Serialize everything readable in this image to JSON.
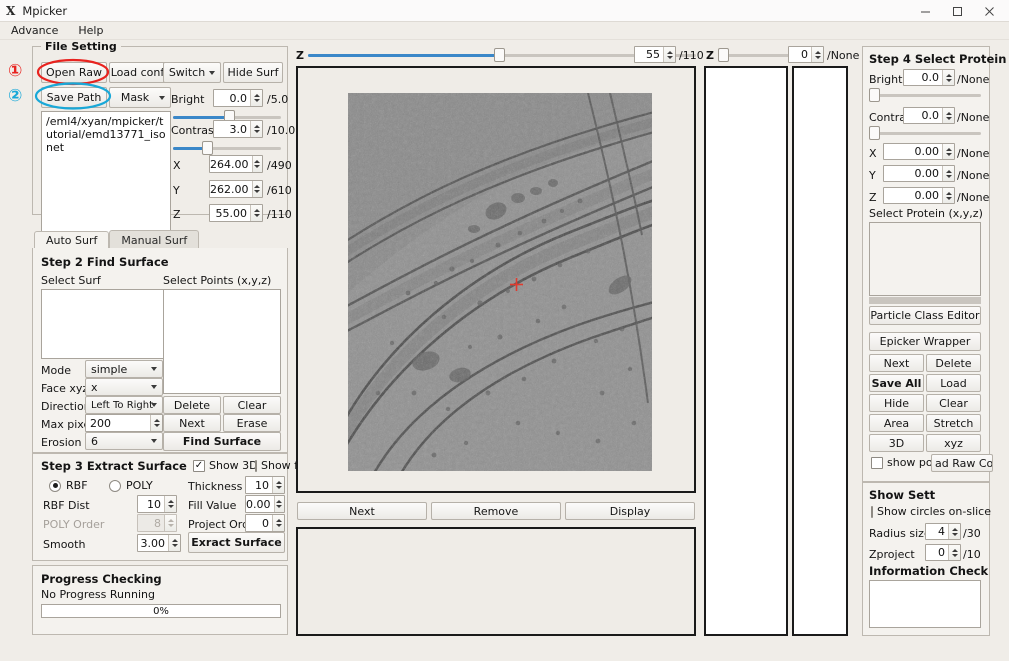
{
  "window": {
    "app_logo": "X",
    "title": "Mpicker",
    "minimize_icon": "minimize-icon",
    "maximize_icon": "maximize-icon",
    "close_icon": "close-icon"
  },
  "menubar": {
    "items": [
      "Advance",
      "Help"
    ]
  },
  "annotations": [
    {
      "number": "①",
      "target": "Open Raw",
      "color": "#e8231f"
    },
    {
      "number": "②",
      "target": "Save Path",
      "color": "#19a8d8"
    }
  ],
  "file_setting": {
    "title": "File Setting",
    "open_raw": "Open Raw",
    "load_config": "Load config",
    "switch": "Switch",
    "hide_surf": "Hide Surf",
    "save_path": "Save Path",
    "mask": "Mask",
    "path_value": "/eml4/xyan/mpicker/tutorial/emd13771_isonet",
    "bright_label": "Bright",
    "bright_value": "0.0",
    "bright_max": "/5.0",
    "bright_slider_pct": 50,
    "contrast_label": "Contrast",
    "contrast_value": "3.0",
    "contrast_max": "/10.0",
    "contrast_slider_pct": 30,
    "x_label": "X",
    "x_value": "264.00",
    "x_max": "/490",
    "y_label": "Y",
    "y_value": "262.00",
    "y_max": "/610",
    "z_label": "Z",
    "z_value": "55.00",
    "z_max": "/110"
  },
  "tabs": {
    "auto_surf": "Auto Surf",
    "manual_surf": "Manual Surf",
    "selected": "Auto Surf"
  },
  "step2": {
    "title": "Step 2 Find Surface",
    "select_surf_label": "Select Surf",
    "select_points_label": "Select Points (x,y,z)",
    "select_surf_items": [],
    "select_points_items": [],
    "mode_label": "Mode",
    "mode_value": "simple",
    "face_label": "Face xyz",
    "face_value": "x",
    "direction_label": "Direction",
    "direction_value": "Left To Right",
    "maxpixel_label": "Max pixel",
    "maxpixel_value": "200",
    "erosion_label": "Erosion",
    "erosion_value": "6",
    "delete": "Delete",
    "clear": "Clear",
    "next": "Next",
    "erase": "Erase",
    "find_surface": "Find Surface"
  },
  "step3": {
    "title": "Step 3 Extract Surface",
    "show3d_label": "Show 3D",
    "show3d_checked": true,
    "showfit_label": "Show fittin",
    "showfit_checked": false,
    "rbf_label": "RBF",
    "rbf_selected": true,
    "poly_label": "POLY",
    "poly_selected": false,
    "thickness_label": "Thickness",
    "thickness_value": "10",
    "rbfdist_label": "RBF Dist",
    "rbfdist_value": "10",
    "fillvalue_label": "Fill Value",
    "fillvalue_value": "0.00",
    "polyorder_label": "POLY Order",
    "polyorder_value": "8",
    "polyorder_disabled": true,
    "projectorder_label": "Project Order",
    "projectorder_value": "0",
    "smooth_label": "Smooth",
    "smooth_value": "3.00",
    "extract_surface": "Exract Surface"
  },
  "progress": {
    "title": "Progress Checking",
    "status": "No Progress Running",
    "percent_label": "0%",
    "percent": 0
  },
  "viewer": {
    "z_label": "Z",
    "z_value": "55",
    "z_max": "/110",
    "z_slider_pct": 50,
    "z2_label": "Z",
    "z2_value": "0",
    "z2_max": "/None",
    "z2_slider_pct": 0,
    "marker_color": "#e03b2f",
    "buttons": {
      "next": "Next",
      "remove": "Remove",
      "display": "Display"
    }
  },
  "step4": {
    "title": "Step 4 Select Protein",
    "bright_label": "Bright",
    "bright_value": "0.0",
    "bright_max": "/None",
    "bright_slider_pct": 0,
    "contrast_label": "Contra",
    "contrast_value": "0.0",
    "contrast_max": "/None",
    "contrast_slider_pct": 0,
    "x_label": "X",
    "x_value": "0.00",
    "x_max": "/None",
    "y_label": "Y",
    "y_value": "0.00",
    "y_max": "/None",
    "z_label": "Z",
    "z_value": "0.00",
    "z_max": "/None",
    "select_protein_label": "Select Protein (x,y,z)",
    "select_protein_items": [],
    "particle_class_editor": "Particle Class Editor",
    "epicker_wrapper": "Epicker Wrapper",
    "next": "Next",
    "delete": "Delete",
    "save_all": "Save All",
    "load": "Load",
    "hide": "Hide",
    "clear": "Clear",
    "area": "Area",
    "stretch": "Stretch",
    "three_d": "3D",
    "xyz": "xyz",
    "show_point_label": "show point",
    "show_point_checked": false,
    "load_raw_coor": "ad Raw Coo"
  },
  "show_setting": {
    "title": "Show Sett",
    "show_circles_label": "Show circles on-slice o",
    "show_circles_checked": false,
    "radius_label": "Radius size",
    "radius_value": "4",
    "radius_max": "/30",
    "zproject_label": "Zproject",
    "zproject_value": "0",
    "zproject_max": "/10",
    "info_title": "Information Check",
    "info_value": ""
  }
}
